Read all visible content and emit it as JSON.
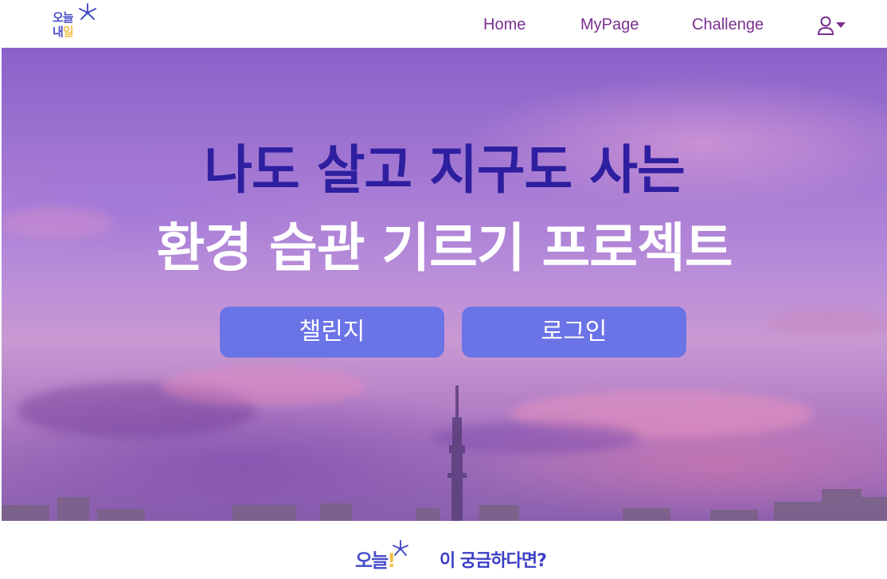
{
  "logo": {
    "line1": "오늘",
    "line2_a": "내",
    "line2_b": "일",
    "flower_icon": "flower-icon",
    "colors": {
      "primary": "#4a4fc9",
      "accent": "#f2c14a"
    }
  },
  "nav": {
    "items": [
      {
        "label": "Home"
      },
      {
        "label": "MyPage"
      },
      {
        "label": "Challenge"
      }
    ],
    "user_icon": "user-icon",
    "caret_icon": "caret-down-icon",
    "color": "#7a2f8f"
  },
  "hero": {
    "title_line1": "나도 살고 지구도 사는",
    "title_line2": "환경 습관 기르기 프로젝트",
    "buttons": {
      "challenge": "챌린지",
      "login": "로그인"
    },
    "colors": {
      "title1": "#2e1fa0",
      "title2": "#ffffff",
      "button": "#6b74e6"
    }
  },
  "footer": {
    "logo_text_a": "오",
    "logo_text_b": "늘",
    "logo_text_c": "!",
    "flower_icon": "flower-icon",
    "text": "이 궁금하다면?"
  }
}
